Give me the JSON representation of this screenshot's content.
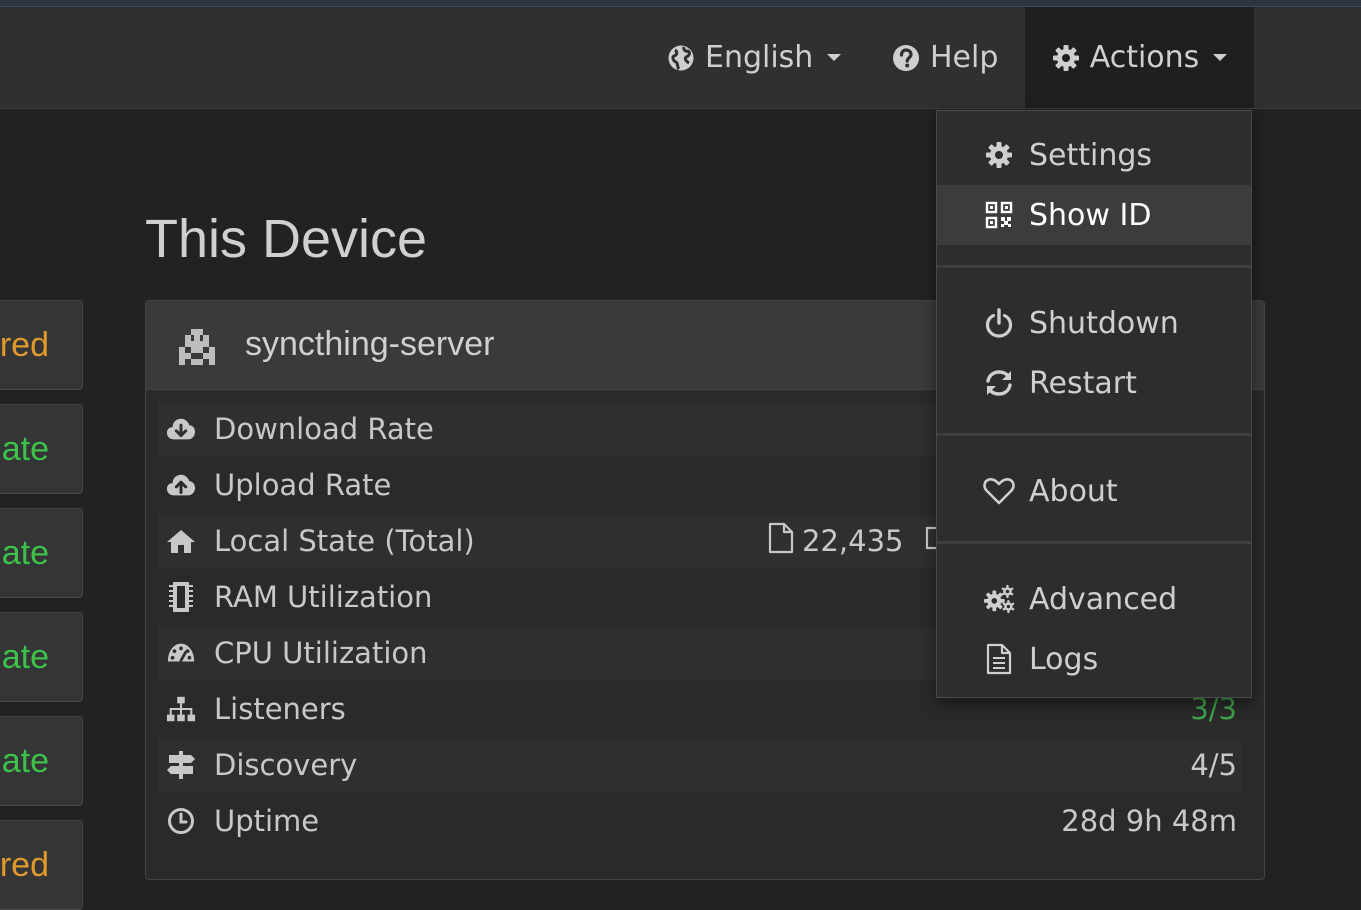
{
  "navbar": {
    "language_label": "English",
    "help_label": "Help",
    "actions_label": "Actions"
  },
  "left_badges": [
    "red",
    "ate",
    "ate",
    "ate",
    "ate",
    "red"
  ],
  "colors": {
    "orange": "#e09a2b",
    "green": "#3cc24a",
    "accent_green": "#3fa34a"
  },
  "page_title": "This Device",
  "device": {
    "name": "syncthing-server",
    "rows": [
      {
        "icon": "cloud-download-icon",
        "label": "Download Rate",
        "value": ""
      },
      {
        "icon": "cloud-upload-icon",
        "label": "Upload Rate",
        "value": ""
      },
      {
        "icon": "home-icon",
        "label": "Local State (Total)",
        "value": "22,435"
      },
      {
        "icon": "memory-chip-icon",
        "label": "RAM Utilization",
        "value": ""
      },
      {
        "icon": "dashboard-icon",
        "label": "CPU Utilization",
        "value": ""
      },
      {
        "icon": "sitemap-icon",
        "label": "Listeners",
        "value": "3/3"
      },
      {
        "icon": "signpost-icon",
        "label": "Discovery",
        "value": "4/5"
      },
      {
        "icon": "clock-icon",
        "label": "Uptime",
        "value": "28d 9h 48m"
      }
    ]
  },
  "actions_menu": {
    "items": [
      {
        "label": "Settings",
        "icon": "gear-icon"
      },
      {
        "label": "Show ID",
        "icon": "qrcode-icon"
      },
      {
        "label": "Shutdown",
        "icon": "power-icon"
      },
      {
        "label": "Restart",
        "icon": "refresh-icon"
      },
      {
        "label": "About",
        "icon": "heart-icon"
      },
      {
        "label": "Advanced",
        "icon": "cogs-icon"
      },
      {
        "label": "Logs",
        "icon": "file-text-icon"
      }
    ]
  }
}
